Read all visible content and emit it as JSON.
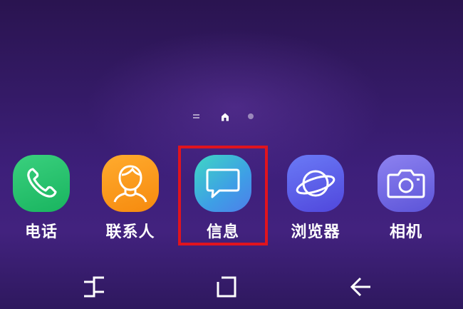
{
  "apps": [
    {
      "label": "电话",
      "icon": "phone-icon",
      "color": "#1dbb66"
    },
    {
      "label": "联系人",
      "icon": "contact-person-icon",
      "color": "#f7920f"
    },
    {
      "label": "信息",
      "icon": "chat-bubble-icon",
      "color": "#3ea6e6"
    },
    {
      "label": "浏览器",
      "icon": "planet-icon",
      "color": "#5a5ee8"
    },
    {
      "label": "相机",
      "icon": "camera-icon",
      "color": "#6f66e2"
    }
  ],
  "page_indicator": {
    "pages": 3,
    "current": "home"
  },
  "highlight": {
    "target": "信息",
    "color": "#e0141e"
  },
  "navbar": [
    "recent-apps",
    "home",
    "back"
  ]
}
